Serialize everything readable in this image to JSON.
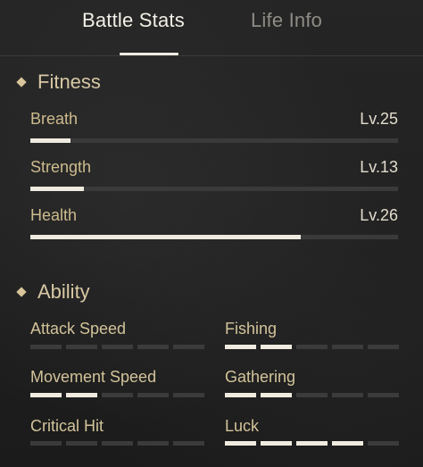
{
  "tabs": [
    {
      "label": "Battle Stats",
      "active": true
    },
    {
      "label": "Life Info",
      "active": false
    }
  ],
  "fitness": {
    "title": "Fitness",
    "stats": [
      {
        "label": "Breath",
        "level": "Lv.25",
        "progress": 0.11
      },
      {
        "label": "Strength",
        "level": "Lv.13",
        "progress": 0.145
      },
      {
        "label": "Health",
        "level": "Lv.26",
        "progress": 0.735
      }
    ]
  },
  "ability": {
    "title": "Ability",
    "items": [
      {
        "label": "Attack Speed",
        "filled": 0,
        "total": 5
      },
      {
        "label": "Fishing",
        "filled": 2,
        "total": 5
      },
      {
        "label": "Movement Speed",
        "filled": 2,
        "total": 5
      },
      {
        "label": "Gathering",
        "filled": 2,
        "total": 5
      },
      {
        "label": "Critical Hit",
        "filled": 0,
        "total": 5
      },
      {
        "label": "Luck",
        "filled": 4,
        "total": 5
      }
    ]
  },
  "colors": {
    "accent": "#d8c59a",
    "bar_fill": "#eeeadf",
    "bar_track": "#3a3a3a"
  }
}
